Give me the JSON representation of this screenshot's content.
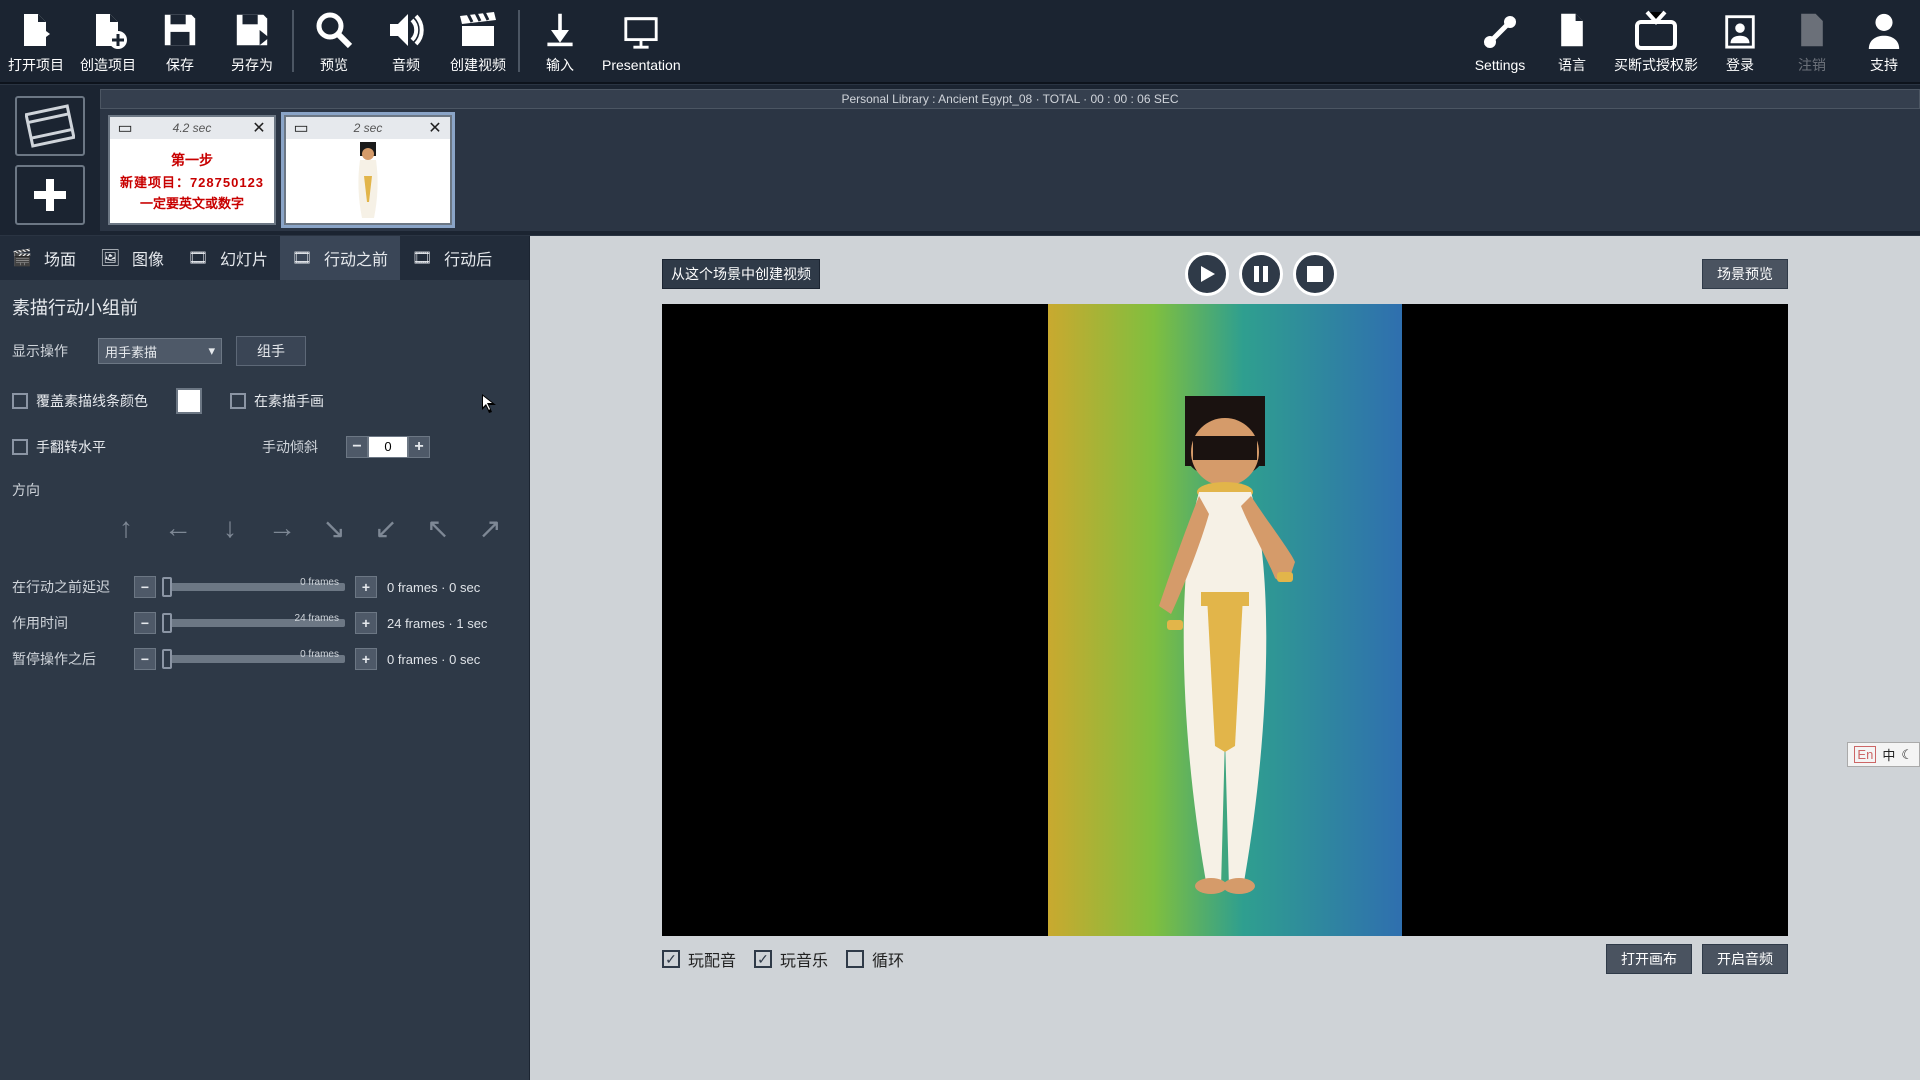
{
  "toolbar": {
    "left": [
      {
        "id": "open",
        "label": "打开项目",
        "icon": "file-open-icon"
      },
      {
        "id": "new",
        "label": "创造项目",
        "icon": "file-new-icon"
      },
      {
        "id": "save",
        "label": "保存",
        "icon": "save-icon"
      },
      {
        "id": "saveas",
        "label": "另存为",
        "icon": "save-as-icon"
      },
      {
        "id": "preview",
        "label": "预览",
        "icon": "magnifier-icon"
      },
      {
        "id": "audio",
        "label": "音频",
        "icon": "speaker-icon"
      },
      {
        "id": "makevideo",
        "label": "创建视频",
        "icon": "clapper-icon"
      },
      {
        "id": "import",
        "label": "输入",
        "icon": "download-icon"
      },
      {
        "id": "presentation",
        "label": "Presentation",
        "icon": "present-icon"
      }
    ],
    "right": [
      {
        "id": "settings",
        "label": "Settings",
        "icon": "tools-icon"
      },
      {
        "id": "language",
        "label": "语言",
        "icon": "page-icon"
      },
      {
        "id": "license",
        "label": "买断式授权影",
        "icon": "tv-icon"
      },
      {
        "id": "login",
        "label": "登录",
        "icon": "badge-icon"
      },
      {
        "id": "logout",
        "label": "注销",
        "icon": "page-disabled-icon",
        "disabled": true
      },
      {
        "id": "support",
        "label": "支持",
        "icon": "person-icon"
      }
    ]
  },
  "strip": {
    "title": "Personal Library : Ancient Egypt_08  ·  TOTAL · 00 : 00 : 06 SEC",
    "frames": [
      {
        "duration": "4.2 sec",
        "lines": [
          "第一步",
          "新建项目：728750123",
          "一定要英文或数字"
        ]
      },
      {
        "duration": "2 sec",
        "active": true
      }
    ]
  },
  "tabs": [
    {
      "id": "scene",
      "label": "场面"
    },
    {
      "id": "image",
      "label": "图像"
    },
    {
      "id": "slide",
      "label": "幻灯片"
    },
    {
      "id": "before",
      "label": "行动之前",
      "active": true
    },
    {
      "id": "after",
      "label": "行动后"
    }
  ],
  "panel": {
    "title": "素描行动小组前",
    "show_label": "显示操作",
    "select_value": "用手素描",
    "group_button": "组手",
    "chk_override": "覆盖素描线条颜色",
    "chk_sketch_hand": "在素描手画",
    "chk_flip": "手翻转水平",
    "tilt_label": "手动倾斜",
    "tilt_value": "0",
    "direction_label": "方向",
    "sliders": [
      {
        "label": "在行动之前延迟",
        "frames_label": "0 frames",
        "value": "0 frames · 0 sec"
      },
      {
        "label": "作用时间",
        "frames_label": "24 frames",
        "value": "24 frames · 1 sec"
      },
      {
        "label": "暂停操作之后",
        "frames_label": "0 frames",
        "value": "0 frames · 0 sec"
      }
    ]
  },
  "preview": {
    "create_label": "从这个场景中创建视频",
    "scene_button": "场景预览",
    "bottom_checks": [
      {
        "label": "玩配音",
        "checked": true
      },
      {
        "label": "玩音乐",
        "checked": true
      },
      {
        "label": "循环",
        "checked": false
      }
    ],
    "bottom_buttons": [
      "打开画布",
      "开启音频"
    ]
  },
  "ime": {
    "a": "En",
    "b": "中",
    "c": "☾"
  }
}
